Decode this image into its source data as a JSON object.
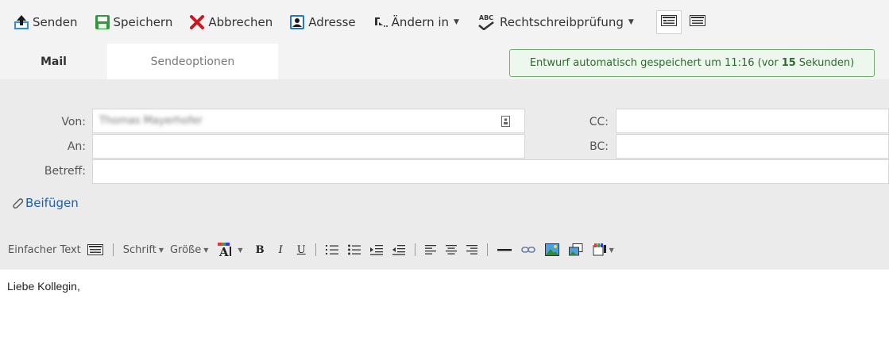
{
  "toolbar": {
    "send_label": "Senden",
    "save_label": "Speichern",
    "cancel_label": "Abbrechen",
    "address_label": "Adresse",
    "change_label": "Ändern in",
    "spellcheck_label": "Rechtschreibprüfung",
    "spellcheck_badge": "ABC",
    "icons": {
      "send": "send-icon",
      "save": "save-icon",
      "cancel": "close-icon",
      "address": "address-book-icon",
      "change": "change-format-icon",
      "spellcheck": "spellcheck-icon",
      "view_html": "view-html-icon",
      "view_text": "view-text-icon"
    }
  },
  "tabs": [
    {
      "label": "Mail",
      "active": true
    },
    {
      "label": "Sendeoptionen",
      "active": false
    }
  ],
  "autosave": {
    "prefix": "Entwurf automatisch gespeichert um 11:16 (vor",
    "seconds": "15",
    "suffix": "Sekunden)"
  },
  "fields": {
    "from_label": "Von:",
    "from_value": "Thomas Mayerhofer",
    "to_label": "An:",
    "to_value": "",
    "subject_label": "Betreff:",
    "subject_value": "",
    "cc_label": "CC:",
    "cc_value": "",
    "bc_label": "BC:",
    "bc_value": ""
  },
  "attach_label": "Beifügen",
  "editor_toolbar": {
    "plain_text_label": "Einfacher Text",
    "font_label": "Schrift",
    "size_label": "Größe",
    "bold_glyph": "B",
    "italic_glyph": "I",
    "underline_glyph": "U"
  },
  "editor": {
    "body_text": "Liebe Kollegin,"
  },
  "colors": {
    "toolbar_bg": "#f3f3f3",
    "header_bg": "#ebebeb",
    "autosave_border": "#6fae6f",
    "autosave_bg": "#eef7ee",
    "link": "#1f5fa8",
    "cancel_red": "#c8191e",
    "save_green": "#2e9b3a",
    "send_blue": "#1f78c8"
  }
}
